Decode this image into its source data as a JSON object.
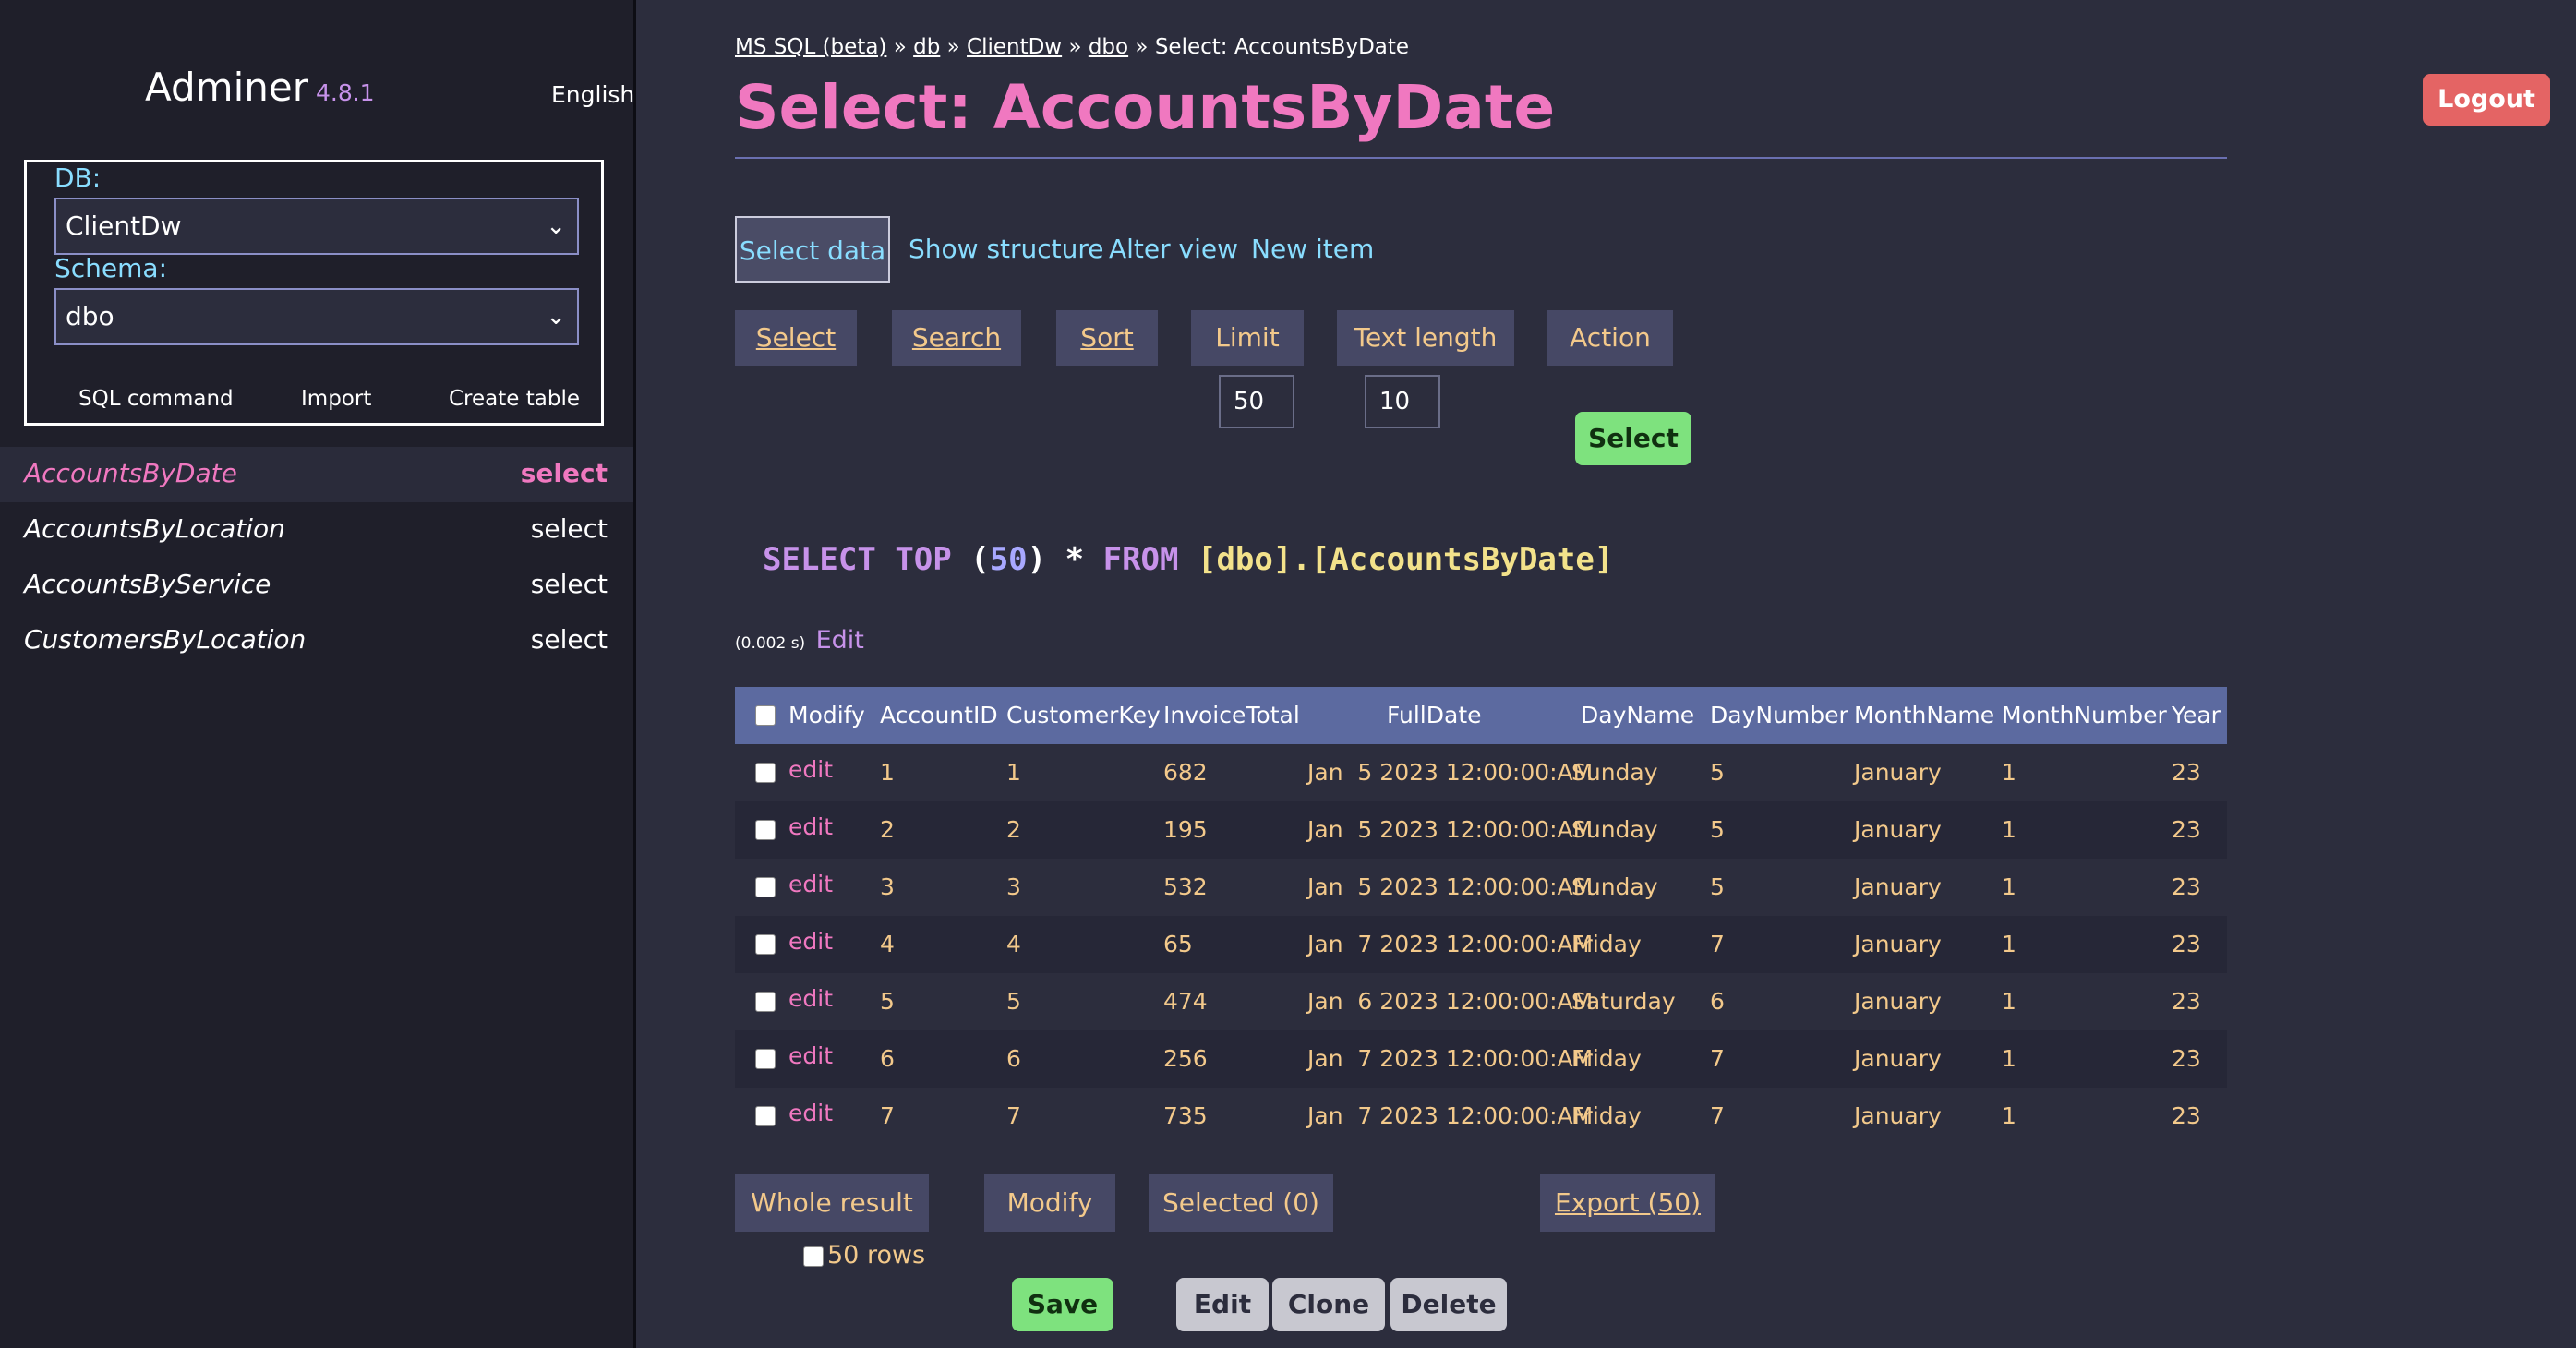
{
  "sidebar": {
    "app_name": "Adminer",
    "version": "4.8.1",
    "language": "English",
    "db_label": "DB:",
    "db_value": "ClientDw",
    "schema_label": "Schema:",
    "schema_value": "dbo",
    "links": [
      "SQL command",
      "Import",
      "Create table"
    ],
    "tables": [
      {
        "name": "AccountsByDate",
        "action": "select"
      },
      {
        "name": "AccountsByLocation",
        "action": "select"
      },
      {
        "name": "AccountsByService",
        "action": "select"
      },
      {
        "name": "CustomersByLocation",
        "action": "select"
      }
    ]
  },
  "header": {
    "breadcrumb": [
      "MS SQL (beta)",
      "db",
      "ClientDw",
      "dbo",
      "Select: AccountsByDate"
    ],
    "breadcrumb_sep": "»",
    "title": "Select: AccountsByDate",
    "logout": "Logout"
  },
  "tabs": [
    "Select data",
    "Show structure",
    "Alter view",
    "New item"
  ],
  "filters": {
    "buttons": [
      "Select",
      "Search",
      "Sort",
      "Limit",
      "Text length",
      "Action"
    ],
    "limit_value": "50",
    "text_length_value": "10",
    "submit": "Select"
  },
  "query": {
    "sql_parts": [
      "SELECT",
      "TOP",
      "(",
      "50",
      ")",
      "*",
      "FROM",
      "[dbo].[AccountsByDate]"
    ],
    "timing": "(0.002 s)",
    "edit": "Edit"
  },
  "table": {
    "modify_header": "Modify",
    "columns": [
      "AccountID",
      "CustomerKey",
      "InvoiceTotal",
      "FullDate",
      "DayName",
      "DayNumber",
      "MonthName",
      "MonthNumber",
      "Year"
    ],
    "edit_label": "edit",
    "rows": [
      [
        "1",
        "1",
        "682",
        "Jan  5 2023 12:00:00:AM",
        "Sunday",
        "5",
        "January",
        "1",
        "23"
      ],
      [
        "2",
        "2",
        "195",
        "Jan  5 2023 12:00:00:AM",
        "Sunday",
        "5",
        "January",
        "1",
        "23"
      ],
      [
        "3",
        "3",
        "532",
        "Jan  5 2023 12:00:00:AM",
        "Sunday",
        "5",
        "January",
        "1",
        "23"
      ],
      [
        "4",
        "4",
        "65",
        "Jan  7 2023 12:00:00:AM",
        "Friday",
        "7",
        "January",
        "1",
        "23"
      ],
      [
        "5",
        "5",
        "474",
        "Jan  6 2023 12:00:00:AM",
        "Saturday",
        "6",
        "January",
        "1",
        "23"
      ],
      [
        "6",
        "6",
        "256",
        "Jan  7 2023 12:00:00:AM",
        "Friday",
        "7",
        "January",
        "1",
        "23"
      ],
      [
        "7",
        "7",
        "735",
        "Jan  7 2023 12:00:00:AM",
        "Friday",
        "7",
        "January",
        "1",
        "23"
      ]
    ]
  },
  "bottom": {
    "whole_result": "Whole result",
    "modify": "Modify",
    "selected": "Selected (0)",
    "export": "Export (50)",
    "rows_checkbox": "50 rows",
    "save": "Save",
    "edit": "Edit",
    "clone": "Clone",
    "delete": "Delete"
  }
}
